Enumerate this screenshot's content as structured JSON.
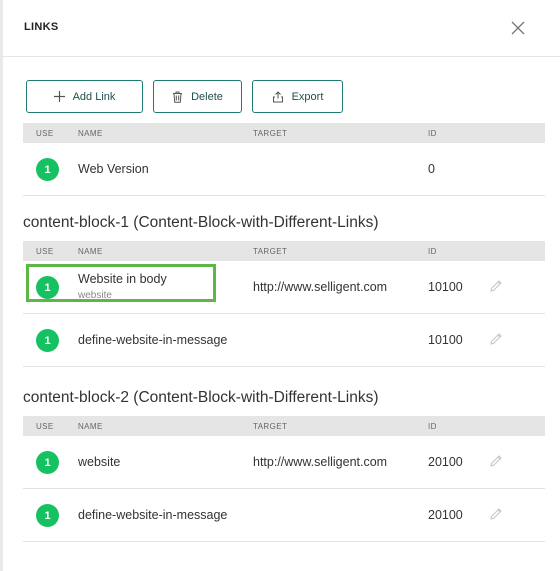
{
  "dialog": {
    "title": "LINKS"
  },
  "toolbar": {
    "add_label": "Add Link",
    "delete_label": "Delete",
    "export_label": "Export"
  },
  "columns": {
    "use": "USE",
    "name": "NAME",
    "target": "TARGET",
    "id": "ID"
  },
  "main_rows": [
    {
      "use": "1",
      "name": "Web Version",
      "target": "",
      "id": "0"
    }
  ],
  "sections": [
    {
      "title": "content-block-1 (Content-Block-with-Different-Links)",
      "rows": [
        {
          "use": "1",
          "name": "Website in body",
          "subname": "website",
          "target": "http://www.selligent.com",
          "id": "10100"
        },
        {
          "use": "1",
          "name": "define-website-in-message",
          "target": "",
          "id": "10100"
        }
      ]
    },
    {
      "title": "content-block-2 (Content-Block-with-Different-Links)",
      "rows": [
        {
          "use": "1",
          "name": "website",
          "target": "http://www.selligent.com",
          "id": "20100"
        },
        {
          "use": "1",
          "name": "define-website-in-message",
          "target": "",
          "id": "20100"
        }
      ]
    }
  ],
  "colors": {
    "accent": "#1f7a73",
    "badge": "#15c160",
    "highlight": "#5db745"
  }
}
